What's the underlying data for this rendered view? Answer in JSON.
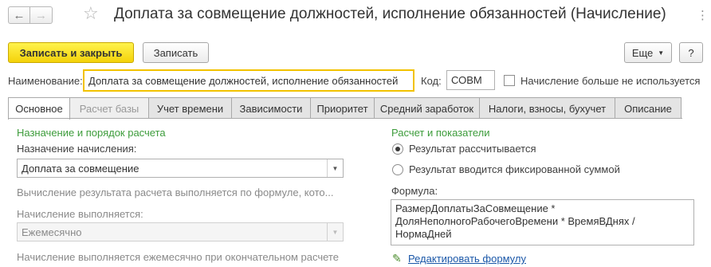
{
  "window": {
    "title": "Доплата за совмещение должностей, исполнение обязанностей (Начисление)",
    "back_icon": "arrow-left",
    "forward_icon": "arrow-right",
    "favorite_icon": "star",
    "menu_icon": "vertical-dots"
  },
  "toolbar": {
    "save_close_label": "Записать и закрыть",
    "save_label": "Записать",
    "more_label": "Еще",
    "help_label": "?"
  },
  "header": {
    "name_label": "Наименование:",
    "name_value": "Доплата за совмещение должностей, исполнение обязанностей",
    "code_label": "Код:",
    "code_value": "СОВМ",
    "unused_label": "Начисление больше не используется"
  },
  "tabs": [
    {
      "label": "Основное"
    },
    {
      "label": "Расчет базы"
    },
    {
      "label": "Учет времени"
    },
    {
      "label": "Зависимости"
    },
    {
      "label": "Приоритет"
    },
    {
      "label": "Средний заработок"
    },
    {
      "label": "Налоги, взносы, бухучет"
    },
    {
      "label": "Описание"
    }
  ],
  "left": {
    "section_title": "Назначение и порядок расчета",
    "purpose_label": "Назначение начисления:",
    "purpose_value": "Доплата за совмещение",
    "formula_note": "Вычисление результата расчета выполняется по формуле, кото...",
    "frequency_label": "Начисление выполняется:",
    "frequency_value": "Ежемесячно",
    "frequency_note": "Начисление выполняется ежемесячно при окончательном расчете"
  },
  "right": {
    "section_title": "Расчет и показатели",
    "radio_calculated": "Результат рассчитывается",
    "radio_fixed": "Результат вводится фиксированной суммой",
    "formula_label": "Формула:",
    "formula_lines": [
      "РазмерДоплатыЗаСовмещение *",
      "ДоляНеполногоРабочегоВремени * ВремяВДнях /",
      "НормаДней"
    ],
    "edit_formula_link": "Редактировать формулу"
  },
  "colors": {
    "primary_button": "#f4d20a",
    "section_title": "#3d9c3b",
    "link": "#1a57a8",
    "focus_border": "#f2c200"
  }
}
